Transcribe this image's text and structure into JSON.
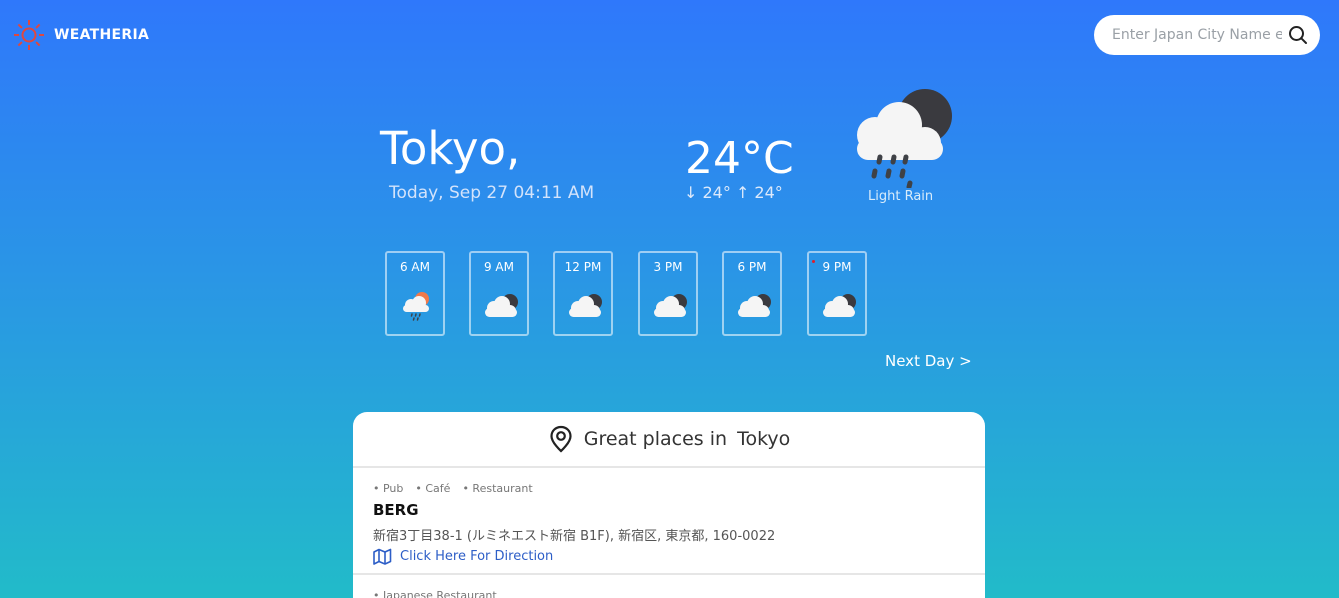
{
  "brand": {
    "name": "WEATHERIA",
    "icon": "sun-icon"
  },
  "search": {
    "placeholder": "Enter Japan City Name e.g. Osaka",
    "icon": "search-icon"
  },
  "current": {
    "city": "Tokyo,",
    "date": "Today, Sep 27 04:11 AM",
    "temp": "24°C",
    "minmax": "↓ 24°  ↑ 24°",
    "condition": "Light Rain",
    "icon": "rain-cloud-night-icon"
  },
  "hourly": [
    {
      "time": "6 AM",
      "icon": "rain-cloud-sun-icon"
    },
    {
      "time": "9 AM",
      "icon": "cloud-night-icon"
    },
    {
      "time": "12 PM",
      "icon": "cloud-night-icon"
    },
    {
      "time": "3 PM",
      "icon": "cloud-night-icon"
    },
    {
      "time": "6 PM",
      "icon": "cloud-night-icon"
    },
    {
      "time": "9 PM",
      "icon": "cloud-night-icon"
    }
  ],
  "next_day": "Next Day >",
  "places": {
    "title_prefix": "Great places in",
    "title_city": "Tokyo",
    "items": [
      {
        "tags": [
          "• Pub",
          "• Café",
          "• Restaurant"
        ],
        "name": "BERG",
        "address": "新宿3丁目38-1 (ルミネエスト新宿 B1F), 新宿区, 東京都, 160-0022",
        "direction": "Click Here For Direction"
      },
      {
        "tags": [
          "• Japanese Restaurant"
        ]
      }
    ]
  },
  "colors": {
    "accent": "#2f78fb",
    "link": "#2d5ec7",
    "brand_icon": "#e0483e"
  }
}
